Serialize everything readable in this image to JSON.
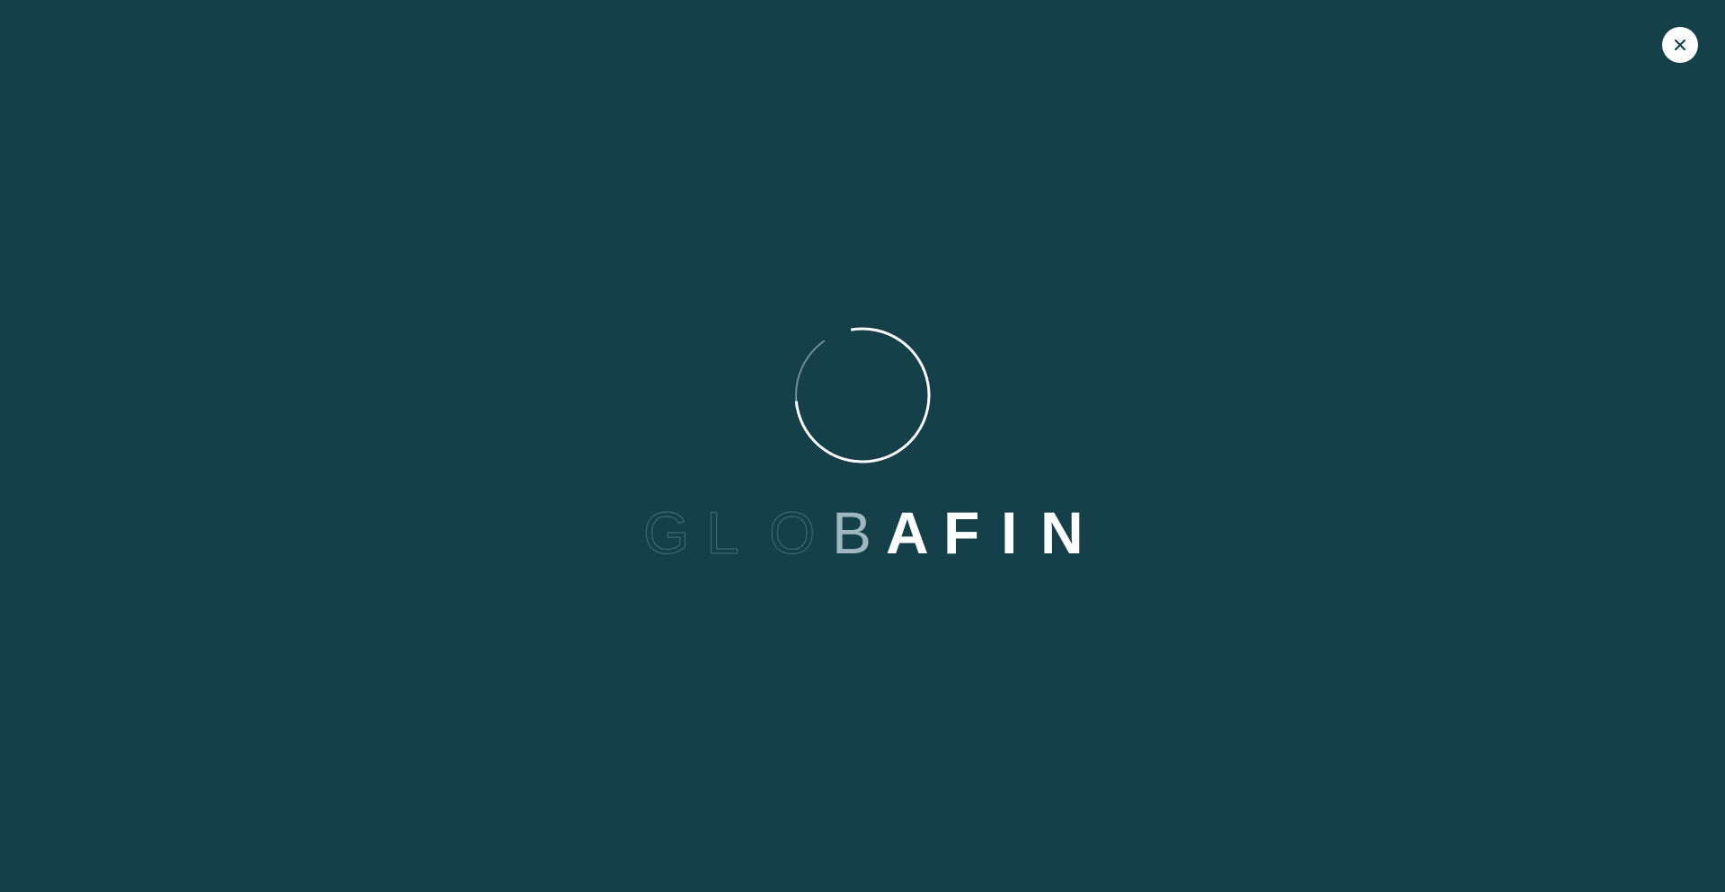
{
  "window": {
    "background_color": "#15404a"
  },
  "close_button": {
    "icon": "close-icon",
    "color": "#ffffff",
    "icon_color": "#15404a"
  },
  "loader": {
    "icon": "spinner-ring-icon",
    "ring_color": "#ffffff",
    "fade_color": "#6d8c93"
  },
  "logo": {
    "letters": [
      "G",
      "L",
      "O",
      "B",
      "A",
      "F",
      "I",
      "N"
    ],
    "ghost_color": "#3f6670",
    "solid_color": "#ffffff"
  }
}
